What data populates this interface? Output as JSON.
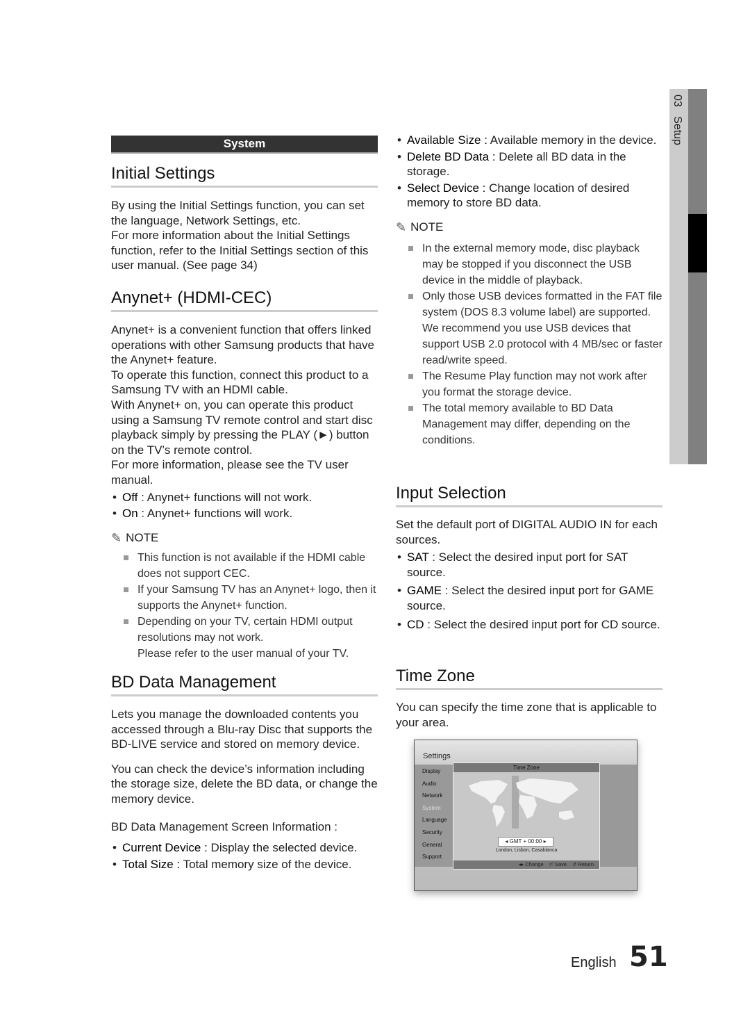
{
  "side_tab": {
    "chapter": "03",
    "title": "Setup"
  },
  "section_bar": "System",
  "initial_settings": {
    "heading": "Initial Settings",
    "paragraphs": [
      "By using the Initial Settings function, you can set the language, Network Settings, etc.",
      "For more information about the Initial Settings function, refer to the Initial Settings section of this user manual. (See page 34)"
    ]
  },
  "anynet": {
    "heading": "Anynet+ (HDMI-CEC)",
    "paragraphs": [
      "Anynet+ is a convenient function that offers linked operations with other Samsung products that have the Anynet+ feature.",
      "To operate this function, connect this product to a Samsung TV with an HDMI cable.",
      "With Anynet+ on, you can operate this product using a Samsung TV remote control and start disc playback simply by pressing the PLAY (►) button on the TV’s remote control.",
      "For more information, please see the TV user manual."
    ],
    "bullets": [
      {
        "term": "Off",
        "text": " : Anynet+ functions will not work."
      },
      {
        "term": "On",
        "text": " : Anynet+ functions will work."
      }
    ],
    "note_label": "NOTE",
    "notes": [
      "This function is not available if the HDMI cable does not support CEC.",
      "If your Samsung TV has an Anynet+ logo, then it supports the Anynet+ function.",
      "Depending on your TV, certain HDMI output resolutions may not work."
    ],
    "note_extra": "Please refer to the user manual of your TV."
  },
  "bd_data": {
    "heading": "BD Data Management",
    "paragraphs": [
      "Lets you manage the downloaded contents you accessed through a Blu-ray Disc that supports the BD-LIVE service and stored on memory device.",
      "You can check the device’s information including the storage size, delete the BD data, or change the memory device."
    ],
    "subheading": "BD Data Management Screen Information :",
    "bullets": [
      {
        "term": "Current Device :",
        "text": " Display the selected device."
      },
      {
        "term": "Total Size :",
        "text": " Total memory size of the device."
      },
      {
        "term": "Available Size :",
        "text": " Available memory in the device."
      },
      {
        "term": "Delete BD Data :",
        "text": " Delete all BD data in the storage."
      },
      {
        "term": "Select Device :",
        "text": " Change location of desired memory to store BD data."
      }
    ],
    "note_label": "NOTE",
    "notes": [
      "In the external memory mode, disc playback may be stopped if you disconnect the USB device in the middle of playback.",
      "Only those USB devices formatted in the FAT file system (DOS 8.3 volume label) are supported. We recommend you use USB devices that support USB 2.0 protocol with 4 MB/sec or faster read/write speed.",
      "The Resume Play function may not work after you format the storage device.",
      "The total memory available to BD Data Management may differ, depending on the conditions."
    ]
  },
  "input_selection": {
    "heading": "Input Selection",
    "paragraphs": [
      "Set the default port of DIGITAL AUDIO IN for each sources."
    ],
    "bullets": [
      {
        "term": "SAT",
        "text": " : Select the desired input port for SAT source."
      },
      {
        "term": "GAME",
        "text": " : Select the desired input port for GAME source."
      },
      {
        "term": "CD",
        "text": " : Select the desired input port for CD source."
      }
    ]
  },
  "time_zone": {
    "heading": "Time Zone",
    "paragraphs": [
      "You can specify the time zone that is applicable to your area."
    ]
  },
  "screenshot": {
    "title": "Settings",
    "menu": [
      "Display",
      "Audio",
      "Network",
      "System",
      "Language",
      "Security",
      "General",
      "Support"
    ],
    "selected": "System",
    "dialog_title": "Time Zone",
    "gmt": "GMT + 00:00",
    "cities": "London, Lisbon, Casablanca",
    "footer": [
      "◂▸ Change",
      "⏎ Save",
      "↺ Return"
    ]
  },
  "footer": {
    "language": "English",
    "page_number": "51"
  }
}
